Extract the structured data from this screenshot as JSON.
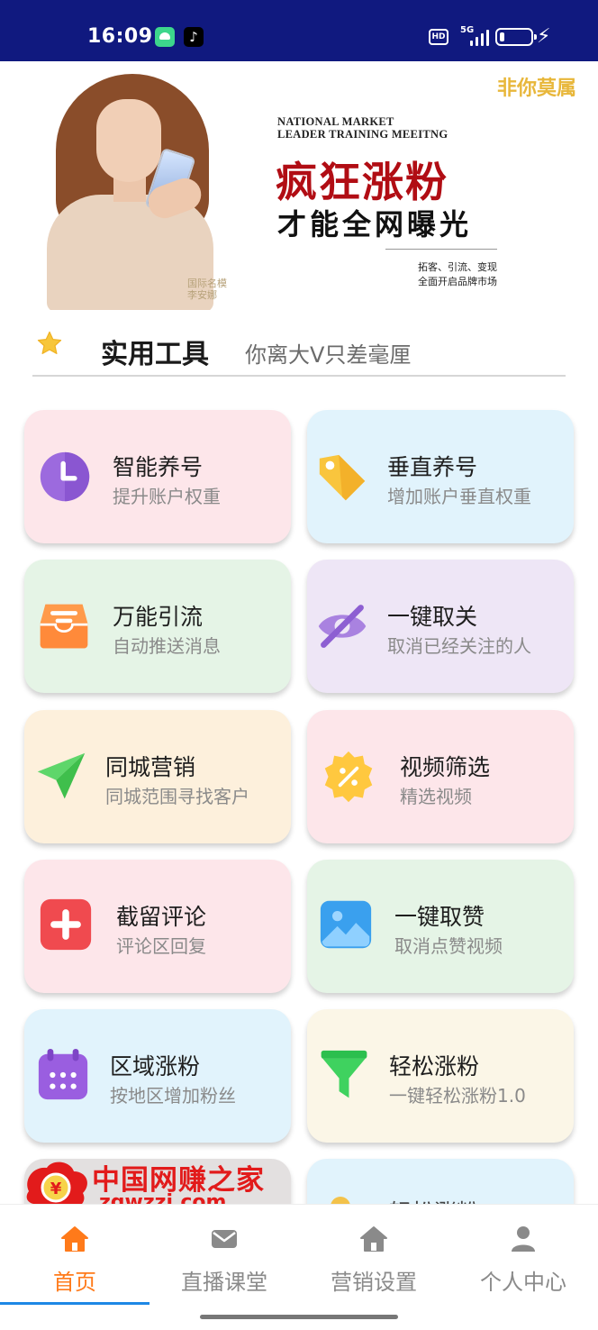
{
  "status_bar": {
    "time": "16:09",
    "network": "5G",
    "hd": "HD",
    "tiktok_glyph": "♪",
    "icons": [
      "android-app-icon",
      "tiktok-icon",
      "hd-icon",
      "signal-icon",
      "battery-icon",
      "charging-icon"
    ],
    "background": "#10197f"
  },
  "banner": {
    "tag": "非你莫属",
    "english_lines": [
      "NATIONAL MARKET",
      "LEADER TRAINING MEEITNG"
    ],
    "headline": "疯狂涨粉",
    "subheadline": "才能全网曝光",
    "small_lines": [
      "拓客、引流、变现",
      "全面开启品牌市场"
    ],
    "model_caption": [
      "国际名模",
      "李安娜"
    ],
    "colors": {
      "headline": "#b10d14",
      "tag": "#e8b73b"
    }
  },
  "section": {
    "title": "实用工具",
    "subtitle": "你离大V只差毫厘",
    "icon": "star-icon"
  },
  "tools": [
    {
      "title": "智能养号",
      "subtitle": "提升账户权重",
      "icon": "clock-icon",
      "bg": "#fde6ea"
    },
    {
      "title": "垂直养号",
      "subtitle": "增加账户垂直权重",
      "icon": "tag-icon",
      "bg": "#e1f3fc"
    },
    {
      "title": "万能引流",
      "subtitle": "自动推送消息",
      "icon": "inbox-icon",
      "bg": "#e5f4e6"
    },
    {
      "title": "一键取关",
      "subtitle": "取消已经关注的人",
      "icon": "eye-off-icon",
      "bg": "#eee6f6"
    },
    {
      "title": "同城营销",
      "subtitle": "同城范围寻找客户",
      "icon": "send-icon",
      "bg": "#fdf0dc"
    },
    {
      "title": "视频筛选",
      "subtitle": "精选视频",
      "icon": "discount-badge-icon",
      "bg": "#fde6ea"
    },
    {
      "title": "截留评论",
      "subtitle": "评论区回复",
      "icon": "plus-icon",
      "bg": "#fde6ea"
    },
    {
      "title": "一键取赞",
      "subtitle": "取消点赞视频",
      "icon": "image-icon",
      "bg": "#e5f4e6"
    },
    {
      "title": "区域涨粉",
      "subtitle": "按地区增加粉丝",
      "icon": "calendar-icon",
      "bg": "#e1f3fc"
    },
    {
      "title": "轻松涨粉",
      "subtitle": "一键轻松涨粉1.0",
      "icon": "filter-icon",
      "bg": "#fbf6e7"
    },
    {
      "title": "",
      "subtitle": "",
      "icon": "",
      "bg": "#e3e0e0"
    },
    {
      "title": "轻松涨粉",
      "subtitle": "",
      "icon": "",
      "bg": "#e1f3fc"
    }
  ],
  "watermark": {
    "text": "中国网赚之家",
    "url": "zgwzzj.com",
    "coin": "¥"
  },
  "bottom_nav": {
    "items": [
      {
        "label": "首页",
        "icon": "home-icon",
        "active": true
      },
      {
        "label": "直播课堂",
        "icon": "mail-icon",
        "active": false
      },
      {
        "label": "营销设置",
        "icon": "home-icon",
        "active": false
      },
      {
        "label": "个人中心",
        "icon": "person-icon",
        "active": false
      }
    ],
    "active_color": "#ff7a1a",
    "indicator_color": "#1e88e5"
  }
}
